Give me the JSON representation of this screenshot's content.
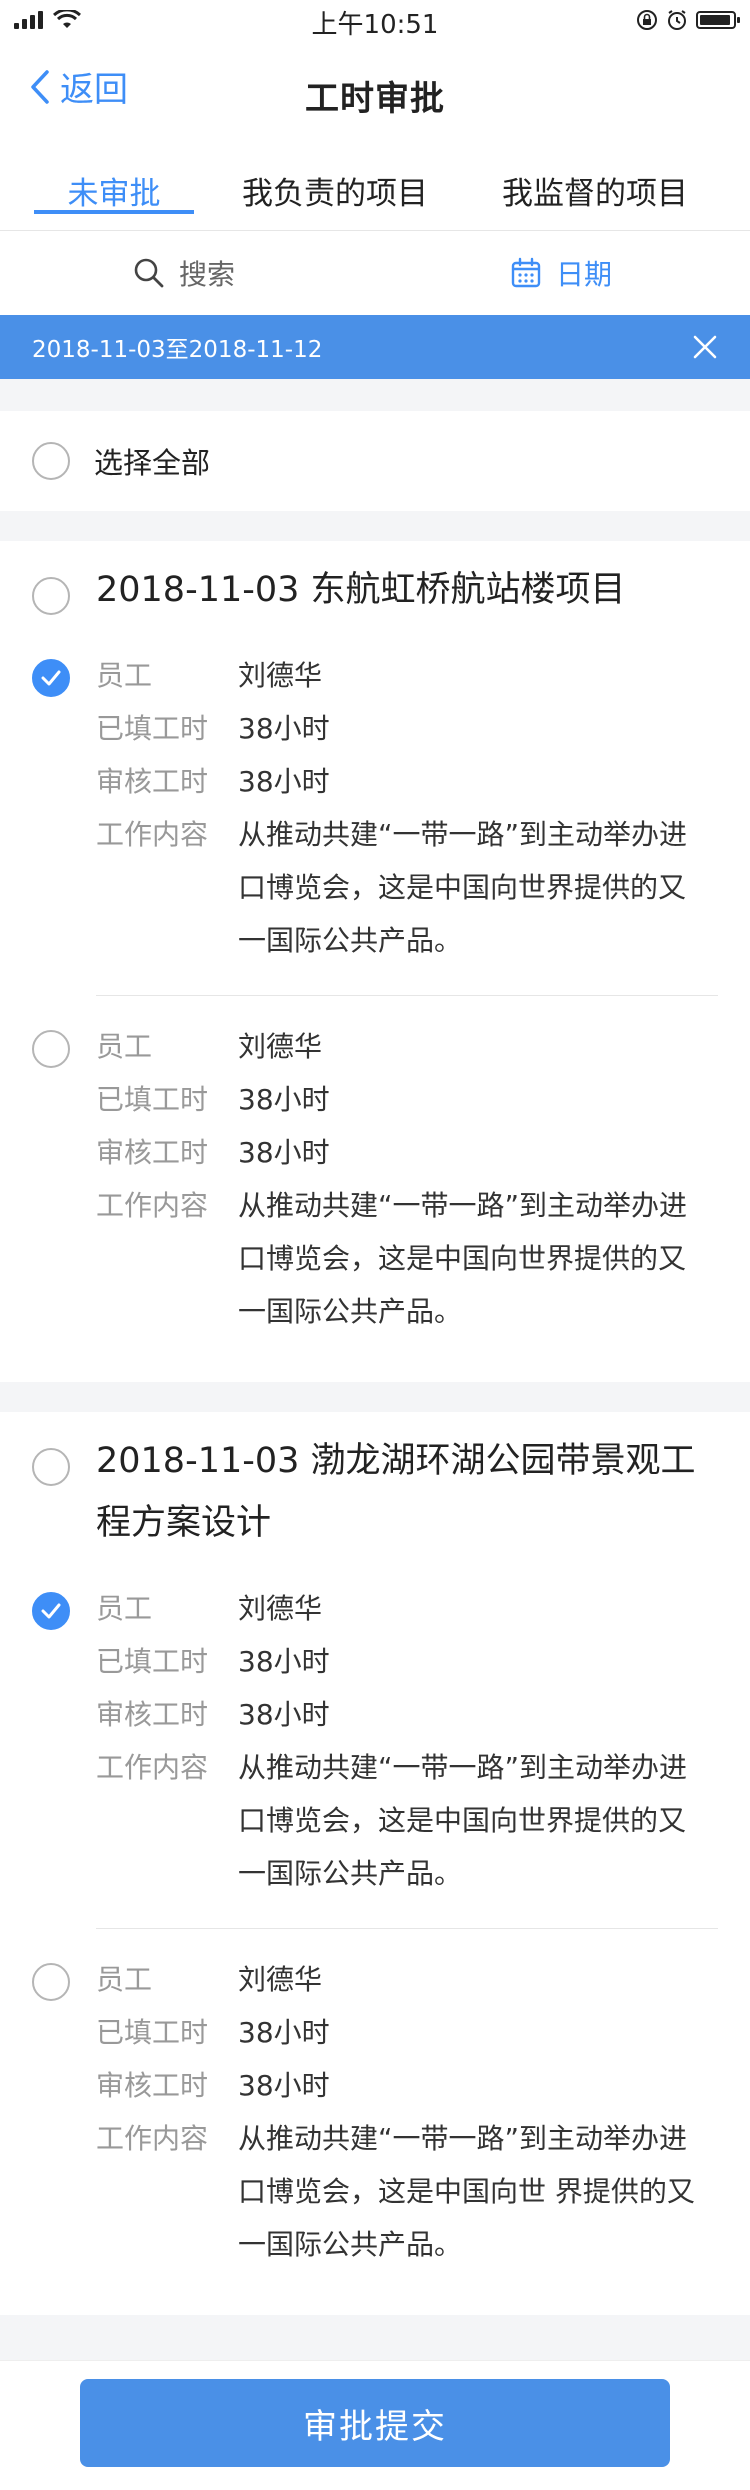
{
  "status": {
    "time": "上午10:51"
  },
  "nav": {
    "back_label": "返回",
    "title": "工时审批"
  },
  "tabs": [
    {
      "label": "未审批"
    },
    {
      "label": "我负责的项目"
    },
    {
      "label": "我监督的项目"
    }
  ],
  "search": {
    "label": "搜索"
  },
  "date": {
    "label": "日期"
  },
  "filter": {
    "range": "2018-11-03至2018-11-12"
  },
  "select_all": {
    "label": "选择全部"
  },
  "labels": {
    "employee": "员工",
    "filled": "已填工时",
    "audited": "审核工时",
    "content": "工作内容"
  },
  "projects": [
    {
      "title": "2018-11-03 东航虹桥航站楼项目",
      "entries": [
        {
          "employee": "刘德华",
          "filled": "38小时",
          "audited": "38小时",
          "content": "从推动共建“一带一路”到主动举办进口博览会，这是中国向世界提供的又一国际公共产品。"
        },
        {
          "employee": "刘德华",
          "filled": "38小时",
          "audited": "38小时",
          "content": "从推动共建“一带一路”到主动举办进口博览会，这是中国向世界提供的又一国际公共产品。"
        }
      ]
    },
    {
      "title": "2018-11-03  渤龙湖环湖公园带景观工程方案设计",
      "entries": [
        {
          "employee": "刘德华",
          "filled": "38小时",
          "audited": "38小时",
          "content": "从推动共建“一带一路”到主动举办进口博览会，这是中国向世界提供的又一国际公共产品。"
        },
        {
          "employee": "刘德华",
          "filled": "38小时",
          "audited": "38小时",
          "content": "从推动共建“一带一路”到主动举办进口博览会，这是中国向世 界提供的又一国际公共产品。"
        }
      ]
    }
  ],
  "submit": {
    "label": "审批提交"
  },
  "colors": {
    "accent": "#3e8ef7",
    "banner": "#4a90e7"
  }
}
